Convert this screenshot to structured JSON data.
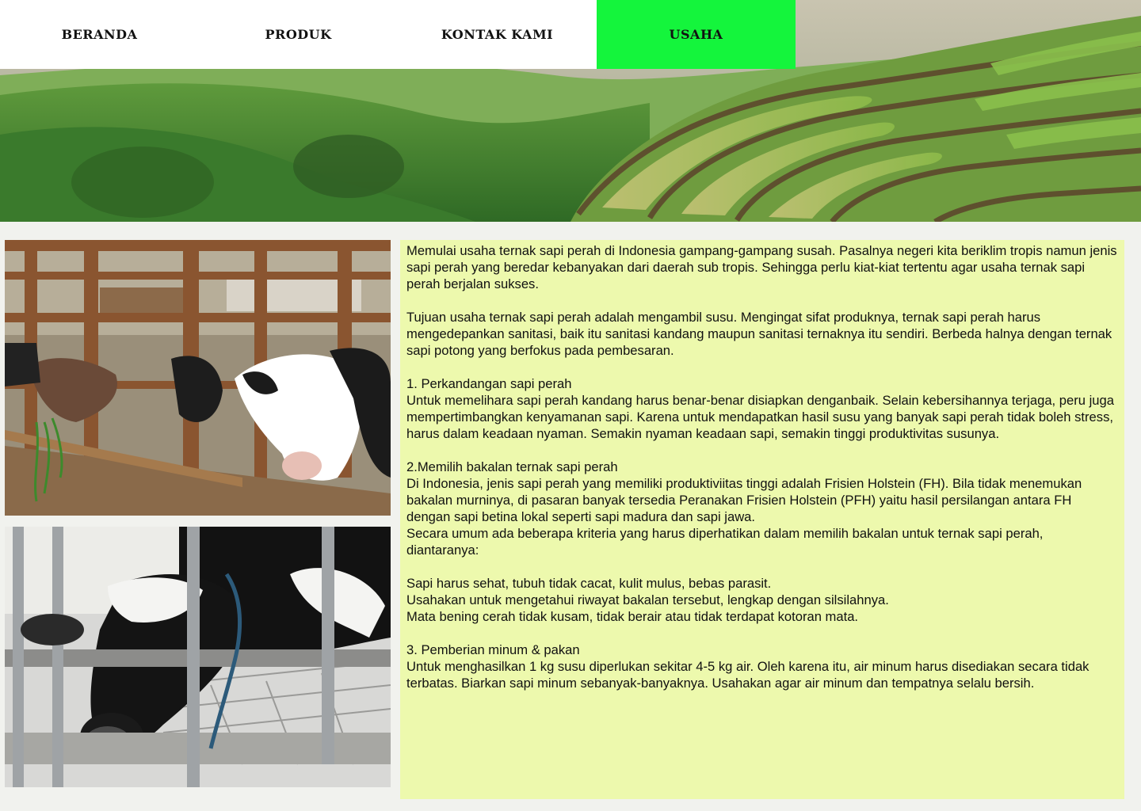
{
  "nav": {
    "items": [
      {
        "label": "BERANDA",
        "active": false
      },
      {
        "label": "PRODUK",
        "active": false
      },
      {
        "label": "KONTAK KAMI",
        "active": false
      },
      {
        "label": "USAHA",
        "active": true
      }
    ],
    "active_color": "#14f53c"
  },
  "hero": {
    "image": "green-terraced-rice-fields-image"
  },
  "photos": [
    {
      "image": "cows-in-wooden-stall-image"
    },
    {
      "image": "holstein-cow-eating-image"
    }
  ],
  "article": {
    "background": "#edf9ad",
    "intro": "Memulai usaha ternak sapi perah di Indonesia gampang-gampang susah. Pasalnya negeri kita beriklim tropis namun jenis sapi perah yang beredar kebanyakan dari daerah sub tropis. Sehingga perlu kiat-kiat tertentu agar usaha ternak sapi perah berjalan sukses.",
    "purpose": "Tujuan usaha ternak sapi perah adalah mengambil susu. Mengingat sifat produknya, ternak sapi perah harus mengedepankan sanitasi, baik itu sanitasi kandang maupun sanitasi ternaknya itu sendiri. Berbeda halnya dengan ternak sapi potong yang berfokus pada pembesaran.",
    "section1": {
      "heading": "1. Perkandangan sapi perah",
      "body": "Untuk memelihara sapi perah kandang harus benar-benar disiapkan denganbaik. Selain kebersihannya terjaga, peru juga mempertimbangkan kenyamanan sapi. Karena untuk mendapatkan hasil susu yang banyak sapi perah tidak boleh stress, harus dalam keadaan nyaman. Semakin nyaman keadaan sapi, semakin tinggi produktivitas susunya."
    },
    "section2": {
      "heading": "2.Memilih bakalan ternak sapi perah",
      "body": "Di Indonesia, jenis sapi perah yang memiliki produktiviitas tinggi adalah Frisien Holstein (FH). Bila tidak menemukan bakalan murninya, di pasaran banyak tersedia Peranakan Frisien Holstein (PFH) yaitu hasil persilangan antara FH dengan sapi betina lokal seperti sapi madura dan sapi jawa.",
      "criteria_intro": "Secara umum ada beberapa kriteria yang harus diperhatikan dalam memilih bakalan untuk ternak sapi perah, diantaranya:",
      "criteria": [
        "Sapi harus sehat, tubuh tidak cacat, kulit mulus, bebas parasit.",
        "Usahakan untuk mengetahui riwayat bakalan tersebut, lengkap dengan silsilahnya.",
        "Mata bening cerah tidak kusam, tidak berair atau tidak terdapat kotoran mata."
      ]
    },
    "section3": {
      "heading": "3. Pemberian minum & pakan",
      "body": "Untuk menghasilkan 1 kg susu diperlukan sekitar 4-5 kg air. Oleh karena itu, air minum harus disediakan secara tidak terbatas. Biarkan sapi minum sebanyak-banyaknya. Usahakan agar air minum dan tempatnya selalu bersih."
    }
  }
}
